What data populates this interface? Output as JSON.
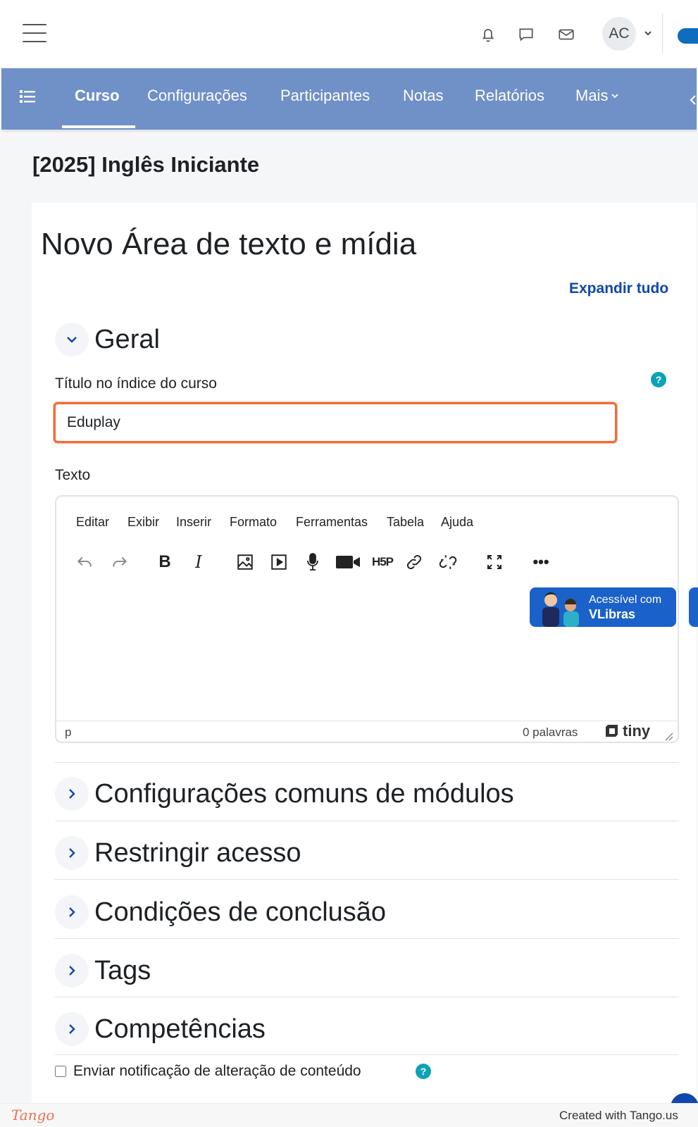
{
  "topbar": {
    "menu_icon": "hamburger-menu-icon",
    "icons": [
      "bell-icon",
      "chat-icon",
      "mail-icon"
    ],
    "avatar_initials": "AC"
  },
  "nav": {
    "tabs": [
      {
        "label": "Curso",
        "active": true
      },
      {
        "label": "Configurações",
        "active": false
      },
      {
        "label": "Participantes",
        "active": false
      },
      {
        "label": "Notas",
        "active": false
      },
      {
        "label": "Relatórios",
        "active": false
      },
      {
        "label": "Mais",
        "active": false
      }
    ]
  },
  "course": {
    "title": "[2025] Inglês Iniciante"
  },
  "page": {
    "heading": "Novo Área de texto e mídia",
    "expand_all": "Expandir tudo"
  },
  "general": {
    "section_title": "Geral",
    "title_label": "Título no índice do curso",
    "title_value": "Eduplay",
    "text_label": "Texto"
  },
  "editor": {
    "menu": [
      "Editar",
      "Exibir",
      "Inserir",
      "Formato",
      "Ferramentas",
      "Tabela",
      "Ajuda"
    ],
    "toolbar": [
      "undo-icon",
      "redo-icon",
      "bold-icon",
      "italic-icon",
      "image-icon",
      "media-icon",
      "microphone-icon",
      "video-camera-icon",
      "h5p-icon",
      "link-icon",
      "unlink-icon",
      "fullscreen-icon",
      "more-icon"
    ],
    "vlibras_line1": "Acessível com",
    "vlibras_line2": "VLibras",
    "status_path": "p",
    "word_count": "0 palavras",
    "brand": "tiny"
  },
  "sections": [
    "Configurações comuns de módulos",
    "Restringir acesso",
    "Condições de conclusão",
    "Tags",
    "Competências"
  ],
  "notify": {
    "label": "Enviar notificação de alteração de conteúdo",
    "checked": false
  },
  "footer": {
    "logo": "Tango",
    "credit": "Created with Tango.us"
  },
  "colors": {
    "nav_bg": "#7090c8",
    "link": "#0f47ad",
    "focus_border": "#f26a3a",
    "help": "#0ca2b8"
  }
}
